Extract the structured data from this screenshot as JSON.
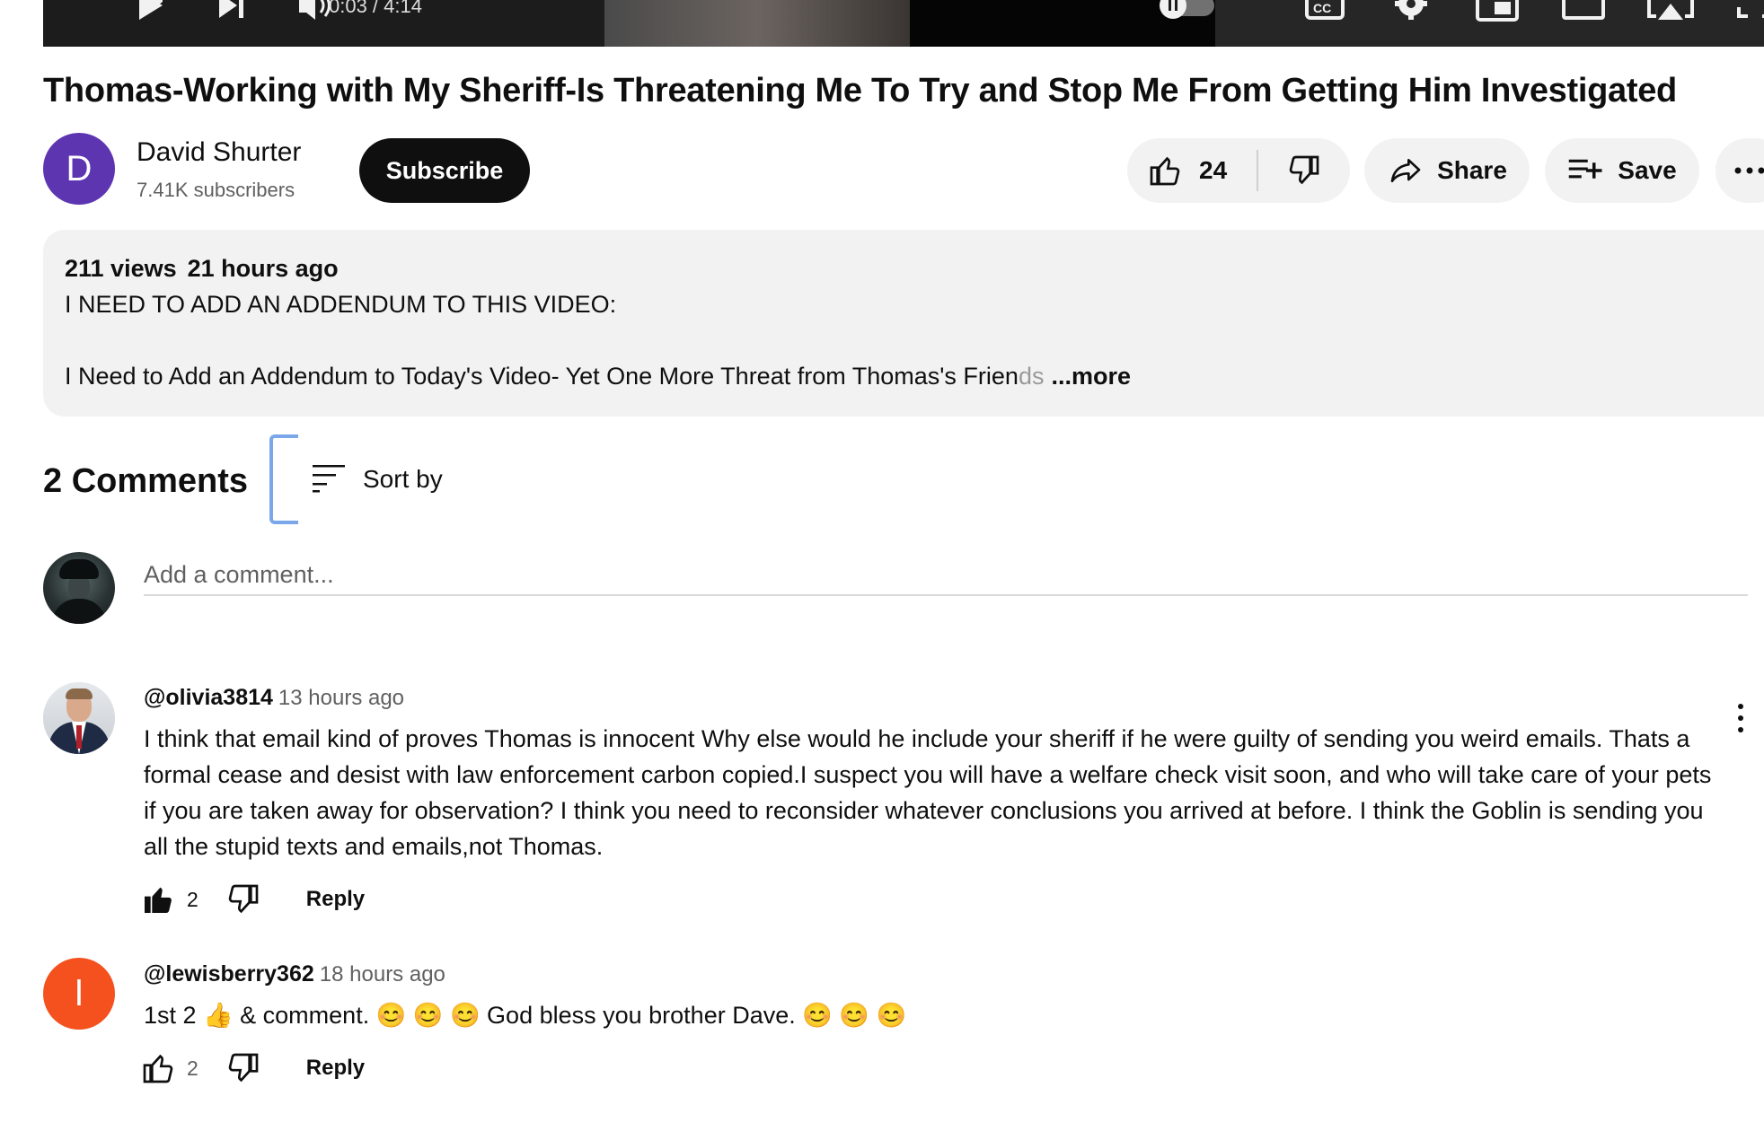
{
  "player": {
    "time": "0:03 / 4:14",
    "controls": [
      "play-icon",
      "next-icon",
      "volume-icon",
      "autoplay-toggle",
      "captions-icon",
      "settings-gear-icon",
      "miniplayer-icon",
      "theater-mode-icon",
      "airplay-icon",
      "fullscreen-icon"
    ]
  },
  "video": {
    "title": "Thomas-Working with My Sheriff-Is Threatening Me To Try and Stop Me From Getting Him Investigated"
  },
  "channel": {
    "avatar_letter": "D",
    "avatar_color": "#5e35b1",
    "name": "David Shurter",
    "subscribers": "7.41K subscribers",
    "subscribe_label": "Subscribe"
  },
  "actions": {
    "like_count": "24",
    "share_label": "Share",
    "save_label": "Save"
  },
  "description": {
    "views": "211 views",
    "ago": "21 hours ago",
    "line1": "I NEED TO ADD AN ADDENDUM TO THIS VIDEO:",
    "line2_main": "I Need to Add an Addendum to Today's Video- Yet One More Threat from Thomas's Frien",
    "line2_fade": "ds",
    "more_label": "...more"
  },
  "comments_header": {
    "count_label": "2 Comments",
    "sort_label": "Sort by"
  },
  "add_comment": {
    "placeholder": "Add a comment..."
  },
  "comments": [
    {
      "author": "@olivia3814",
      "time": "13 hours ago",
      "text": "I think that email kind of proves Thomas is innocent Why else would he include your sheriff if he were guilty of sending you weird emails. Thats a formal cease and desist with law enforcement carbon copied.I suspect you will have a welfare check visit soon, and who will take care of your pets if you are taken away for observation? I think you need to reconsider whatever conclusions you arrived at before. I think the Goblin is sending you all the stupid texts and emails,not Thomas.",
      "likes": "2",
      "reply_label": "Reply",
      "liked": true
    },
    {
      "author": "@lewisberry362",
      "avatar_letter": "l",
      "avatar_color": "#f4511e",
      "time": "18 hours ago",
      "text": "1st 2 👍 & comment.  😊 😊 😊  God bless you brother Dave. 😊 😊 😊",
      "likes": "2",
      "reply_label": "Reply",
      "liked": false
    }
  ]
}
